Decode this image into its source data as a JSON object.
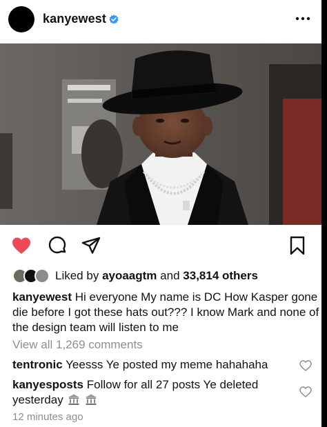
{
  "post": {
    "username": "kanyewest",
    "more_icon": "ellipsis-icon",
    "verified_icon": "verified-badge-icon"
  },
  "photo": {
    "alt": "photo"
  },
  "actions": {
    "like_icon": "heart-filled-icon",
    "comment_icon": "comment-icon",
    "share_icon": "send-icon",
    "save_icon": "bookmark-icon",
    "like_color": "#ed4956"
  },
  "likes": {
    "prefix": "Liked by",
    "user": "ayoaagtm",
    "middle": "and",
    "count": "33,814 others"
  },
  "caption": {
    "username": "kanyewest",
    "text": "Hi everyone  My name is DC  How Kasper gone die before I got these hats out??? I know Mark and none of the design team will listen to me"
  },
  "view_all": "View all 1,269 comments",
  "comments": [
    {
      "username": "tentronic",
      "text": "Yeesss Ye posted my meme hahahaha"
    },
    {
      "username": "kanyesposts",
      "text": "Follow for all 27 posts Ye deleted yesterday"
    }
  ],
  "timestamp": "12 minutes ago",
  "colors": {
    "text": "#111111",
    "secondary": "#8e8e8e",
    "verified": "#3897f0"
  }
}
